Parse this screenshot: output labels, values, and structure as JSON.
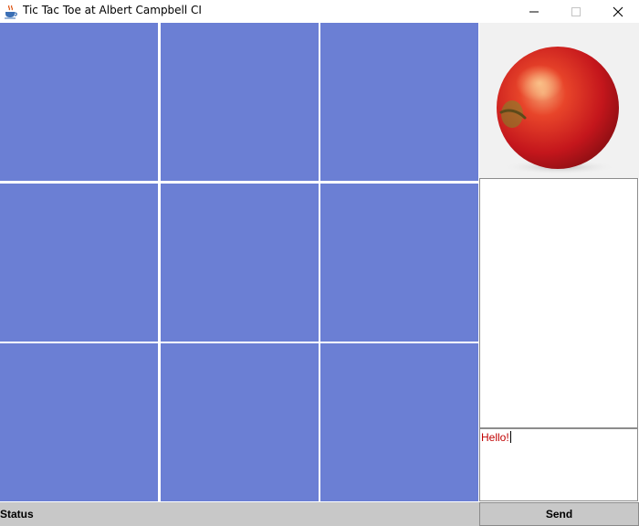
{
  "window": {
    "title": "Tic Tac Toe at Albert Campbell CI",
    "app_icon": "java-coffee-cup-icon",
    "controls": [
      "minimize-icon",
      "maximize-icon",
      "close-icon"
    ]
  },
  "board": {
    "cell_color": "#6b7fd4",
    "cells": [
      "",
      "",
      "",
      "",
      "",
      "",
      "",
      "",
      ""
    ]
  },
  "sidebar": {
    "image": "apple-photo",
    "chat_log": "",
    "chat_input": "Hello!",
    "chat_input_color": "#c00000",
    "send_label": "Send"
  },
  "status": {
    "text": "Status"
  }
}
